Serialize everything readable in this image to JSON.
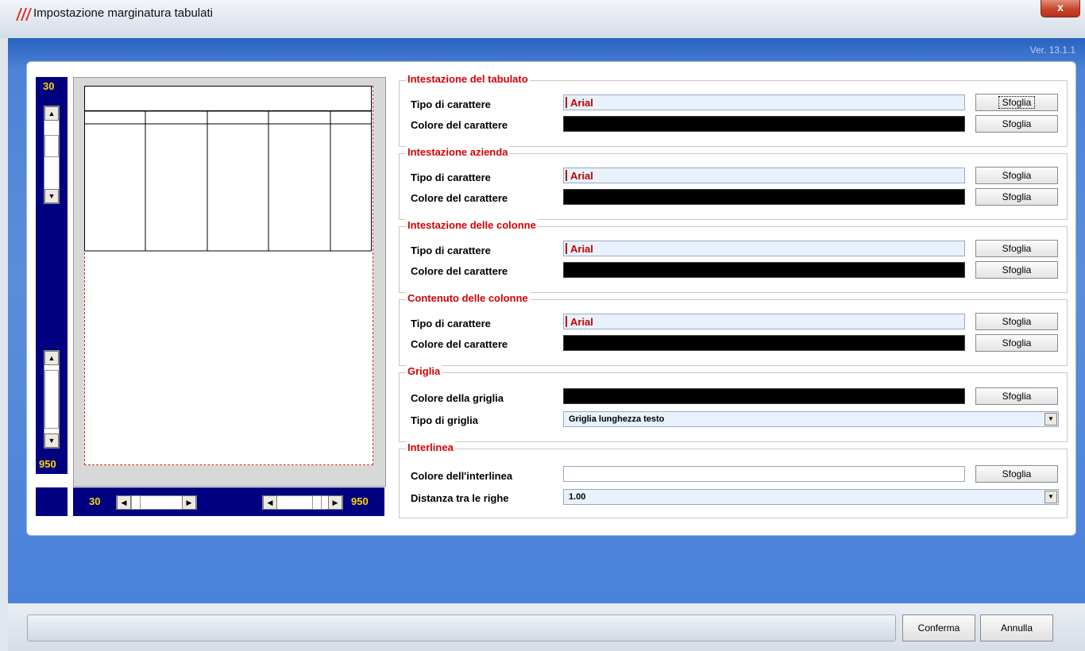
{
  "window": {
    "title": "Impostazione marginatura tabulati",
    "close_label": "x",
    "version": "Ver. 13.1.1"
  },
  "preview": {
    "vertical_top_value": "30",
    "vertical_bottom_value": "950",
    "horizontal_left_value": "30",
    "horizontal_right_value": "950"
  },
  "groups": [
    {
      "title": "Intestazione del tabulato",
      "font_label": "Tipo di carattere",
      "font_value": "Arial",
      "color_label": "Colore del carattere",
      "color_value": "#000000",
      "browse_label": "Sfoglia"
    },
    {
      "title": "Intestazione azienda",
      "font_label": "Tipo di carattere",
      "font_value": "Arial",
      "color_label": "Colore del carattere",
      "color_value": "#000000",
      "browse_label": "Sfoglia"
    },
    {
      "title": "Intestazione delle colonne",
      "font_label": "Tipo di carattere",
      "font_value": "Arial",
      "color_label": "Colore del carattere",
      "color_value": "#000000",
      "browse_label": "Sfoglia"
    },
    {
      "title": "Contenuto delle colonne",
      "font_label": "Tipo di carattere",
      "font_value": "Arial",
      "color_label": "Colore del carattere",
      "color_value": "#000000",
      "browse_label": "Sfoglia"
    }
  ],
  "grid": {
    "title": "Griglia",
    "color_label": "Colore della griglia",
    "color_value": "#000000",
    "browse_label": "Sfoglia",
    "type_label": "Tipo di griglia",
    "type_value": "Griglia lunghezza testo"
  },
  "spacing": {
    "title": "Interlinea",
    "color_label": "Colore dell'interlinea",
    "color_value": "#ffffff",
    "browse_label": "Sfoglia",
    "distance_label": "Distanza tra le righe",
    "distance_value": "1.00"
  },
  "footer": {
    "confirm_label": "Conferma",
    "cancel_label": "Annulla"
  },
  "icons": {
    "scroll_up": "triangle-up-icon",
    "scroll_down": "triangle-down-icon",
    "scroll_left": "triangle-left-icon",
    "scroll_right": "triangle-right-icon",
    "dropdown": "chevron-down-icon"
  }
}
